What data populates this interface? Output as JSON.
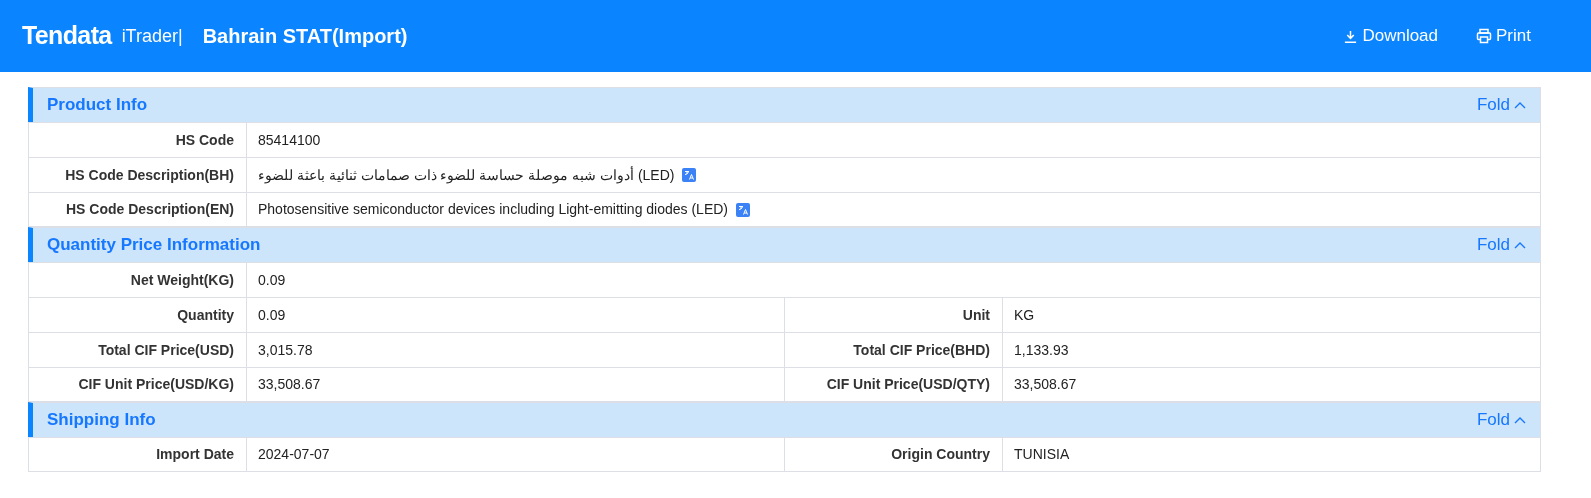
{
  "header": {
    "logo": "Tendata",
    "product": "iTrader|",
    "title": "Bahrain STAT(Import)",
    "actions": [
      {
        "kind": "download",
        "label": "Download"
      },
      {
        "kind": "print",
        "label": "Print"
      }
    ]
  },
  "sections": [
    {
      "title": "Product Info",
      "toggle": "Fold",
      "expanded": true,
      "rows": [
        {
          "fields": [
            {
              "label": "HS Code",
              "value": "85414100"
            }
          ]
        },
        {
          "fields": [
            {
              "label": "HS Code Description(BH)",
              "value": "أدوات شبه موصلة حساسة للضوء ذات صمامات ثنائية باعثة للضوء (LED)",
              "translate": true
            }
          ]
        },
        {
          "fields": [
            {
              "label": "HS Code Description(EN)",
              "value": "Photosensitive semiconductor devices including Light-emitting diodes (LED)",
              "translate": true
            }
          ]
        }
      ]
    },
    {
      "title": "Quantity Price Information",
      "toggle": "Fold",
      "expanded": true,
      "rows": [
        {
          "fields": [
            {
              "label": "Net Weight(KG)",
              "value": "0.09"
            }
          ]
        },
        {
          "fields": [
            {
              "label": "Quantity",
              "value": "0.09"
            },
            {
              "label": "Unit",
              "value": "KG"
            }
          ]
        },
        {
          "fields": [
            {
              "label": "Total CIF Price(USD)",
              "value": "3,015.78"
            },
            {
              "label": "Total CIF Price(BHD)",
              "value": "1,133.93"
            }
          ]
        },
        {
          "fields": [
            {
              "label": "CIF Unit Price(USD/KG)",
              "value": "33,508.67"
            },
            {
              "label": "CIF Unit Price(USD/QTY)",
              "value": "33,508.67"
            }
          ]
        }
      ]
    },
    {
      "title": "Shipping Info",
      "toggle": "Fold",
      "expanded": true,
      "rows": [
        {
          "fields": [
            {
              "label": "Import Date",
              "value": "2024-07-07"
            },
            {
              "label": "Origin Country",
              "value": "TUNISIA"
            }
          ]
        }
      ]
    }
  ]
}
